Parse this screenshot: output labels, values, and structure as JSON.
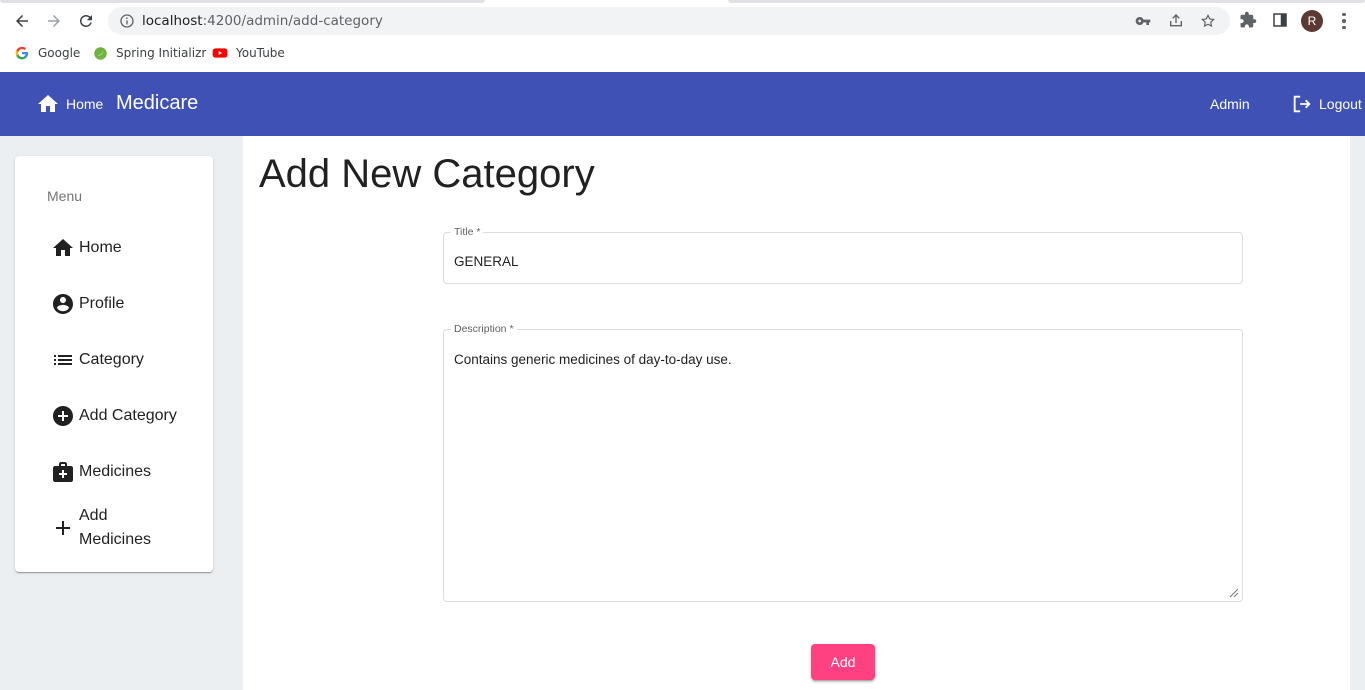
{
  "browser": {
    "url_host": "localhost",
    "url_rest": ":4200/admin/add-category",
    "profile_initial": "R",
    "bookmarks": [
      {
        "label": "Google",
        "icon": "google-icon"
      },
      {
        "label": "Spring Initializr",
        "icon": "spring-icon"
      },
      {
        "label": "YouTube",
        "icon": "youtube-icon"
      }
    ]
  },
  "toolbar": {
    "home_label": "Home",
    "brand": "Medicare",
    "admin_label": "Admin",
    "logout_label": "Logout",
    "color": "#3f51b5"
  },
  "sidebar": {
    "title": "Menu",
    "items": [
      {
        "label": "Home",
        "icon": "home-icon"
      },
      {
        "label": "Profile",
        "icon": "account-circle-icon"
      },
      {
        "label": "Category",
        "icon": "list-icon"
      },
      {
        "label": "Add Category",
        "icon": "add-circle-icon"
      },
      {
        "label": "Medicines",
        "icon": "medical-bag-icon"
      },
      {
        "label": "Add Medicines",
        "icon": "plus-icon"
      }
    ]
  },
  "main": {
    "title": "Add New Category",
    "title_field": {
      "label": "Title *",
      "value": "GENERAL"
    },
    "description_field": {
      "label": "Description *",
      "value": "Contains generic medicines of day-to-day use."
    },
    "add_button": "Add",
    "accent": "#ff4081"
  }
}
